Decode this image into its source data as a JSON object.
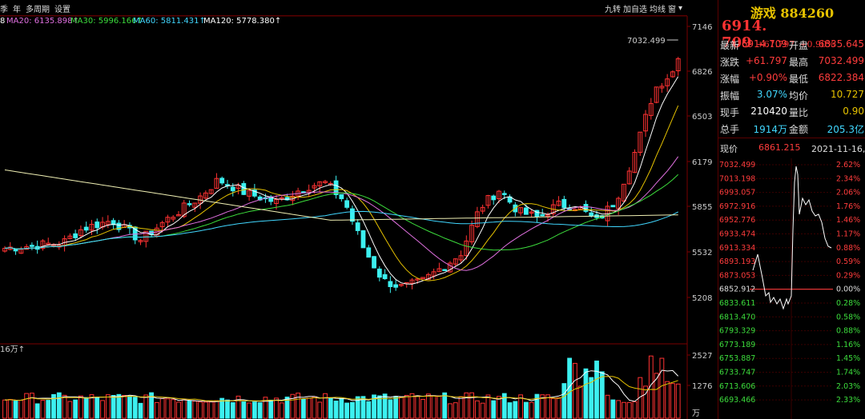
{
  "toolbar": {
    "tabs": [
      "季",
      "年",
      "多周期",
      "设置"
    ],
    "tools": [
      "九转",
      "加自选",
      "均线",
      "窗",
      "▾"
    ]
  },
  "ma_legend": [
    {
      "text": "8",
      "color": "#ffffff"
    },
    {
      "text": "MA20: 6135.898↑",
      "color": "#e070e0"
    },
    {
      "text": "MA30: 5996.166↑",
      "color": "#3cdc3c"
    },
    {
      "text": "MA60: 5811.431↑",
      "color": "#41d7ff"
    },
    {
      "text": "MA120: 5778.380↑",
      "color": "#ffffff"
    }
  ],
  "main_axis": {
    "ticks": [
      "7146",
      "6826",
      "6503",
      "6179",
      "5855",
      "5532",
      "5208"
    ],
    "max_label": "7032.499"
  },
  "volume": {
    "label": "16万↑",
    "ticks": [
      "2527",
      "1276"
    ],
    "unit": "万"
  },
  "colors": {
    "up": "#ff3232",
    "down": "#3cf0f0",
    "ma5": "#ffffff",
    "ma10": "#e6c200",
    "ma20": "#e070e0",
    "ma30": "#3cdc3c",
    "ma60": "#41d7ff",
    "ma120": "#f0f0b4"
  },
  "quote": {
    "title": "游戏 884260",
    "price": "6914. 709",
    "change": "+61.797",
    "pct": "+0.90%",
    "rows": [
      {
        "l1": "最新",
        "v1": "6914.709",
        "c1": "red",
        "l2": "开盘",
        "v2": "6835.645",
        "c2": "red"
      },
      {
        "l1": "涨跌",
        "v1": "+61.797",
        "c1": "red",
        "l2": "最高",
        "v2": "7032.499",
        "c2": "red"
      },
      {
        "l1": "涨幅",
        "v1": "+0.90%",
        "c1": "red",
        "l2": "最低",
        "v2": "6822.384",
        "c2": "red"
      },
      {
        "l1": "振幅",
        "v1": "3.07%",
        "c1": "cyan",
        "l2": "均价",
        "v2": "10.727",
        "c2": "yellow"
      },
      {
        "l1": "现手",
        "v1": "210420",
        "c1": "white",
        "l2": "量比",
        "v2": "0.90",
        "c2": "yellow"
      },
      {
        "l1": "总手",
        "v1": "1914万",
        "c1": "cyan",
        "l2": "金额",
        "v2": "205.3亿",
        "c2": "cyan"
      }
    ]
  },
  "intraday": {
    "label": "现价",
    "price": "6861.215",
    "date": "2021-11-16,二",
    "left_ticks": [
      "7032.499",
      "7013.198",
      "6993.057",
      "6972.916",
      "6952.776",
      "6933.474",
      "6913.334",
      "6893.193",
      "6873.053",
      "6852.912",
      "6833.611",
      "6813.470",
      "6793.329",
      "6773.189",
      "6753.887",
      "6733.747",
      "6713.606",
      "6693.466"
    ],
    "right_ticks": [
      "2.62%",
      "2.34%",
      "2.06%",
      "1.76%",
      "1.46%",
      "1.17%",
      "0.88%",
      "0.59%",
      "0.29%",
      "0.00%",
      "0.28%",
      "0.58%",
      "0.88%",
      "1.16%",
      "1.45%",
      "1.74%",
      "2.03%",
      "2.33%"
    ],
    "base_index": 9
  }
}
